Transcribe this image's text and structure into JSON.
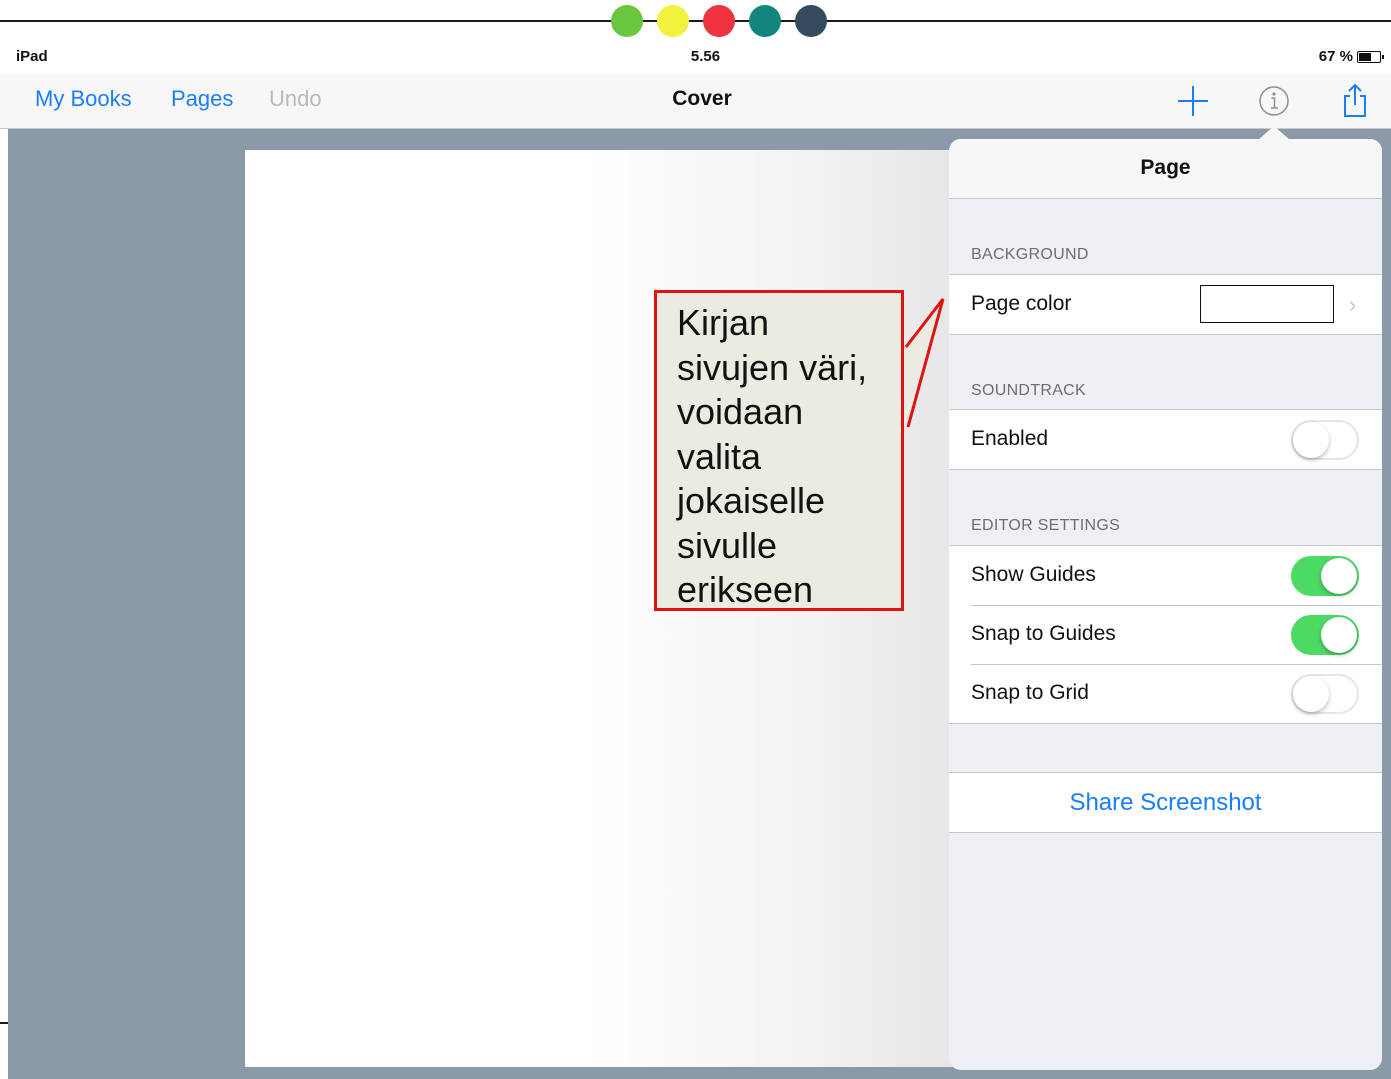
{
  "decoration": {
    "dot_colors": [
      "#6ac63d",
      "#f2f23c",
      "#ef3340",
      "#12857f",
      "#344a5d"
    ]
  },
  "status_bar": {
    "device": "iPad",
    "time": "5.56",
    "battery": "67 %",
    "battery_level": 0.67
  },
  "nav": {
    "my_books": "My Books",
    "pages": "Pages",
    "undo": "Undo",
    "title": "Cover",
    "icons": [
      "plus-icon",
      "info-icon",
      "share-icon"
    ]
  },
  "callout": {
    "text": "Kirjan\nsivujen väri,\nvoidaan\nvalita\njokaiselle\nsivulle\nerikseen"
  },
  "popover": {
    "title": "Page",
    "background": {
      "header": "BACKGROUND",
      "page_color_label": "Page color",
      "page_color_value": "#ffffff"
    },
    "soundtrack": {
      "header": "SOUNDTRACK",
      "enabled_label": "Enabled",
      "enabled": false
    },
    "editor_settings": {
      "header": "EDITOR SETTINGS",
      "items": [
        {
          "label": "Show Guides",
          "on": true
        },
        {
          "label": "Snap to Guides",
          "on": true
        },
        {
          "label": "Snap to Grid",
          "on": false
        }
      ]
    },
    "share_label": "Share Screenshot"
  },
  "colors": {
    "accent_blue": "#1a7ef7",
    "toggle_on": "#4cd964",
    "callout_border": "#e01313",
    "workspace": "#8b9aa8"
  }
}
